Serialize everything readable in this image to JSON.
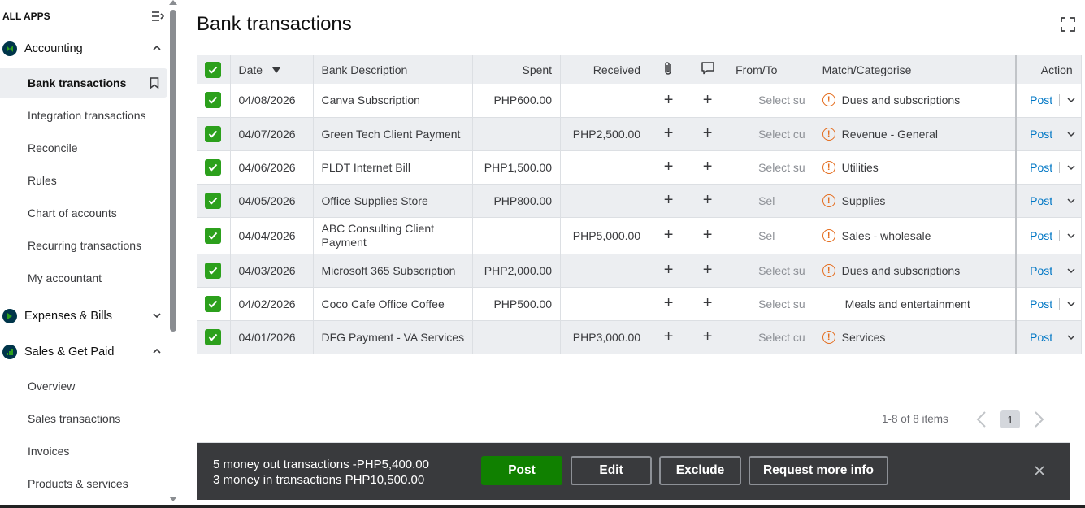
{
  "sidebar": {
    "all_apps": "ALL APPS",
    "sections": [
      {
        "label": "Accounting",
        "expanded": true
      },
      {
        "label": "Expenses & Bills",
        "expanded": false
      },
      {
        "label": "Sales & Get Paid",
        "expanded": true
      }
    ],
    "accounting_items": [
      "Bank transactions",
      "Integration transactions",
      "Reconcile",
      "Rules",
      "Chart of accounts",
      "Recurring transactions",
      "My accountant"
    ],
    "sales_items": [
      "Overview",
      "Sales transactions",
      "Invoices",
      "Products & services"
    ],
    "active_item": "Bank transactions"
  },
  "page": {
    "title": "Bank transactions"
  },
  "table": {
    "headers": {
      "date": "Date",
      "description": "Bank Description",
      "spent": "Spent",
      "received": "Received",
      "from_to": "From/To",
      "match": "Match/Categorise",
      "action": "Action"
    },
    "icons": {
      "attachment": "paperclip-icon",
      "memo": "comment-icon"
    },
    "rows": [
      {
        "date": "04/08/2026",
        "description": "Canva Subscription",
        "spent": "PHP600.00",
        "received": "",
        "from_to": "Select su",
        "category": "Dues and subscriptions",
        "warning": true,
        "action": "Post"
      },
      {
        "date": "04/07/2026",
        "description": "Green Tech Client Payment",
        "spent": "",
        "received": "PHP2,500.00",
        "from_to": "Select cu",
        "category": "Revenue - General",
        "warning": true,
        "action": "Post"
      },
      {
        "date": "04/06/2026",
        "description": "PLDT Internet Bill",
        "spent": "PHP1,500.00",
        "received": "",
        "from_to": "Select su",
        "category": "Utilities",
        "warning": true,
        "action": "Post"
      },
      {
        "date": "04/05/2026",
        "description": "Office Supplies Store",
        "spent": "PHP800.00",
        "received": "",
        "from_to": "Sel",
        "category": "Supplies",
        "warning": true,
        "action": "Post"
      },
      {
        "date": "04/04/2026",
        "description": "ABC Consulting Client Payment",
        "spent": "",
        "received": "PHP5,000.00",
        "from_to": "Sel",
        "category": "Sales - wholesale",
        "warning": true,
        "action": "Post"
      },
      {
        "date": "04/03/2026",
        "description": "Microsoft 365 Subscription",
        "spent": "PHP2,000.00",
        "received": "",
        "from_to": "Select su",
        "category": "Dues and subscriptions",
        "warning": true,
        "action": "Post"
      },
      {
        "date": "04/02/2026",
        "description": "Coco Cafe Office Coffee",
        "spent": "PHP500.00",
        "received": "",
        "from_to": "Select su",
        "category": "Meals and entertainment",
        "warning": false,
        "action": "Post"
      },
      {
        "date": "04/01/2026",
        "description": "DFG Payment - VA Services",
        "spent": "",
        "received": "PHP3,000.00",
        "from_to": "Select cu",
        "category": "Services",
        "warning": true,
        "action": "Post"
      }
    ]
  },
  "pagination": {
    "summary": "1-8 of 8 items",
    "current_page": "1"
  },
  "batch_bar": {
    "money_out": "5 money out transactions -PHP5,400.00",
    "money_in": "3 money in transactions PHP10,500.00",
    "post": "Post",
    "edit": "Edit",
    "exclude": "Exclude",
    "request_info": "Request more info"
  },
  "colors": {
    "accent_green": "#2ca01c",
    "post_green": "#108000",
    "link_blue": "#0077c5",
    "warning_orange": "#e46d1e",
    "bar_dark": "#393a3d"
  }
}
